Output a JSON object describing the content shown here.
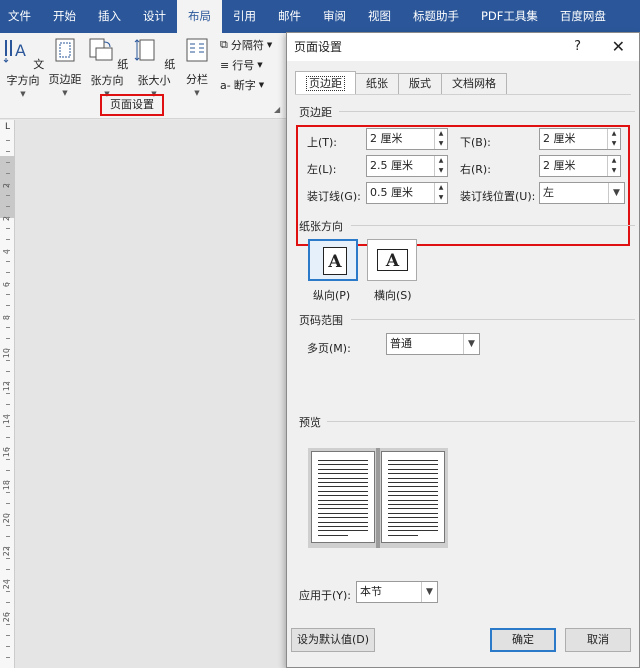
{
  "ribbon": {
    "tabs": [
      "文件",
      "开始",
      "插入",
      "设计",
      "布局",
      "引用",
      "邮件",
      "审阅",
      "视图",
      "标题助手",
      "PDF工具集",
      "百度网盘"
    ],
    "active_tab": "布局",
    "buttons": {
      "text_direction": "文字方向",
      "margins": "页边距",
      "orientation": "纸张方向",
      "size": "纸张大小",
      "columns": "分栏",
      "breaks": "分隔符",
      "line_numbers": "行号",
      "hyphenation": "断字"
    },
    "group_label": "页面设置"
  },
  "ruler": {
    "corner": "L",
    "numbers": [
      "2",
      "2",
      "4",
      "6",
      "8",
      "10",
      "12",
      "14",
      "16",
      "18",
      "20",
      "22",
      "24",
      "26"
    ]
  },
  "dialog": {
    "title": "页面设置",
    "help": "?",
    "close": "✕",
    "tabs": [
      "页边距",
      "纸张",
      "版式",
      "文档网格"
    ],
    "margins_section": "页边距",
    "top_label": "上(T):",
    "top_value": "2 厘米",
    "bottom_label": "下(B):",
    "bottom_value": "2 厘米",
    "left_label": "左(L):",
    "left_value": "2.5 厘米",
    "right_label": "右(R):",
    "right_value": "2 厘米",
    "gutter_label": "装订线(G):",
    "gutter_value": "0.5 厘米",
    "gutter_pos_label": "装订线位置(U):",
    "gutter_pos_value": "左",
    "orientation_section": "纸张方向",
    "portrait": "纵向(P)",
    "landscape": "横向(S)",
    "orientation_glyph": "A",
    "pages_section": "页码范围",
    "multiple_pages_label": "多页(M):",
    "multiple_pages_value": "普通",
    "preview_section": "预览",
    "apply_to_label": "应用于(Y):",
    "apply_to_value": "本节",
    "set_default": "设为默认值(D)",
    "ok": "确定",
    "cancel": "取消"
  }
}
